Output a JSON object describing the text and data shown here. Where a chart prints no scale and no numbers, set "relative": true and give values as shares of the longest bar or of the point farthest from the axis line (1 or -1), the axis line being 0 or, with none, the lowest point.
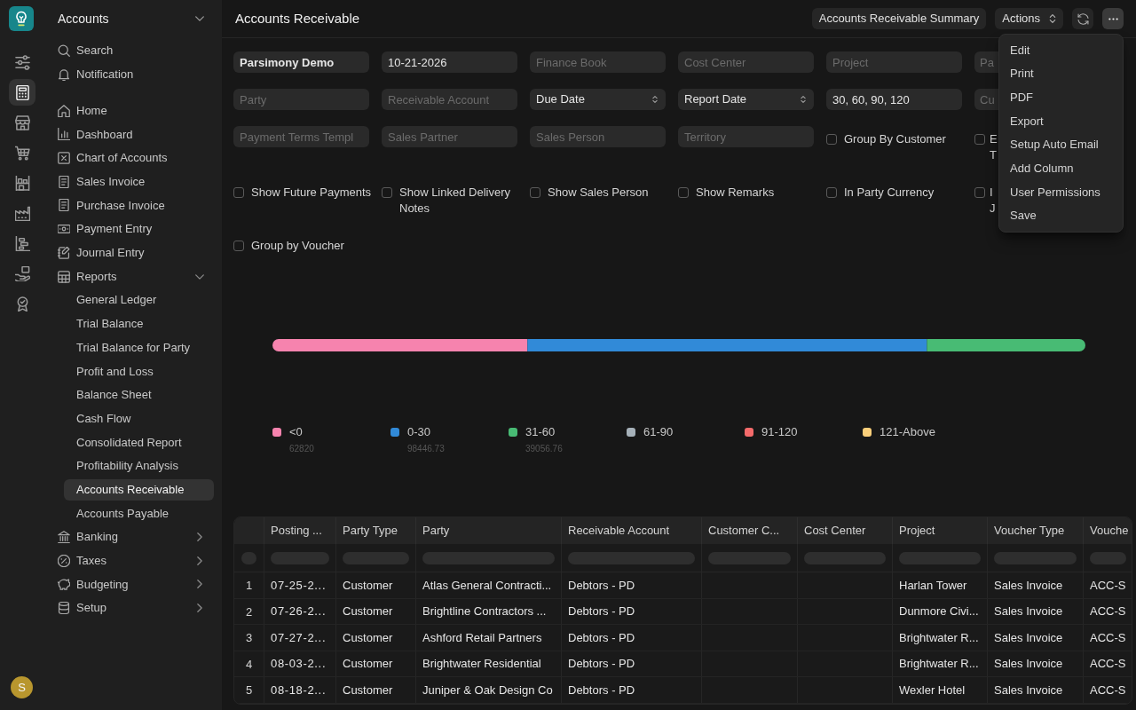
{
  "rail": {
    "items": [
      {
        "selected": false
      },
      {
        "selected": true
      },
      {
        "selected": false
      },
      {
        "selected": false
      },
      {
        "selected": false
      },
      {
        "selected": false
      },
      {
        "selected": false
      },
      {
        "selected": false
      },
      {
        "selected": false
      }
    ]
  },
  "sidebar": {
    "workspace": "Accounts",
    "actions": [
      {
        "label": "Search"
      },
      {
        "label": "Notification"
      }
    ],
    "items": [
      {
        "kind": "link",
        "label": "Home",
        "selected": false
      },
      {
        "kind": "link",
        "label": "Dashboard",
        "selected": false
      },
      {
        "kind": "link",
        "label": "Chart of Accounts",
        "selected": false
      },
      {
        "kind": "link",
        "label": "Sales Invoice",
        "selected": false
      },
      {
        "kind": "link",
        "label": "Purchase Invoice",
        "selected": false
      },
      {
        "kind": "link",
        "label": "Payment Entry",
        "selected": false
      },
      {
        "kind": "link",
        "label": "Journal Entry",
        "selected": false
      },
      {
        "kind": "group",
        "label": "Reports",
        "selected": false,
        "expanded": true,
        "children": [
          {
            "label": "General Ledger",
            "selected": false
          },
          {
            "label": "Trial Balance",
            "selected": false
          },
          {
            "label": "Trial Balance for Party",
            "selected": false
          },
          {
            "label": "Profit and Loss",
            "selected": false
          },
          {
            "label": "Balance Sheet",
            "selected": false
          },
          {
            "label": "Cash Flow",
            "selected": false
          },
          {
            "label": "Consolidated Report",
            "selected": false
          },
          {
            "label": "Profitability Analysis",
            "selected": false
          },
          {
            "label": "Accounts Receivable",
            "selected": true
          },
          {
            "label": "Accounts Payable",
            "selected": false
          }
        ]
      },
      {
        "kind": "group",
        "label": "Banking",
        "selected": false,
        "expanded": false
      },
      {
        "kind": "group",
        "label": "Taxes",
        "selected": false,
        "expanded": false
      },
      {
        "kind": "group",
        "label": "Budgeting",
        "selected": false,
        "expanded": false
      },
      {
        "kind": "group",
        "label": "Setup",
        "selected": false,
        "expanded": false
      }
    ]
  },
  "user": {
    "initial": "S"
  },
  "header": {
    "title": "Accounts Receivable",
    "buttons": [
      {
        "kind": "text",
        "label": "Accounts Receivable Summary"
      },
      {
        "kind": "dropdown",
        "label": "Actions"
      },
      {
        "kind": "refresh"
      },
      {
        "kind": "more",
        "expanded": true
      }
    ]
  },
  "menu": {
    "items": [
      "Edit",
      "Print",
      "PDF",
      "Export",
      "Setup Auto Email",
      "Add Column",
      "User Permissions",
      "Save"
    ]
  },
  "filters": [
    {
      "kind": "link",
      "value": "Parsimony Demo"
    },
    {
      "kind": "date",
      "value": "10-21-2026"
    },
    {
      "kind": "link",
      "placeholder": "Finance Book"
    },
    {
      "kind": "link",
      "placeholder": "Cost Center"
    },
    {
      "kind": "link",
      "placeholder": "Project"
    },
    {
      "kind": "link",
      "placeholder": "Pa"
    },
    {
      "kind": "link",
      "placeholder": "Party"
    },
    {
      "kind": "link",
      "placeholder": "Receivable Account"
    },
    {
      "kind": "select",
      "value": "Due Date"
    },
    {
      "kind": "select",
      "value": "Report Date"
    },
    {
      "kind": "data",
      "value": "30, 60, 90, 120"
    },
    {
      "kind": "link",
      "placeholder": "Cu"
    },
    {
      "kind": "link",
      "placeholder": "Payment Terms Templ"
    },
    {
      "kind": "link",
      "placeholder": "Sales Partner"
    },
    {
      "kind": "link",
      "placeholder": "Sales Person"
    },
    {
      "kind": "link",
      "placeholder": "Territory"
    },
    {
      "kind": "check",
      "label": "Group By Customer",
      "checked": false
    },
    {
      "kind": "check",
      "label": "E T",
      "checked": false
    },
    {
      "kind": "check",
      "label": "Show Future Payments",
      "checked": false
    },
    {
      "kind": "check",
      "label": "Show Linked Delivery Notes",
      "checked": false
    },
    {
      "kind": "check",
      "label": "Show Sales Person",
      "checked": false
    },
    {
      "kind": "check",
      "label": "Show Remarks",
      "checked": false
    },
    {
      "kind": "check",
      "label": "In Party Currency",
      "checked": false
    },
    {
      "kind": "check",
      "label": "I J",
      "checked": false
    },
    {
      "kind": "check",
      "label": "Group by Voucher",
      "checked": false
    }
  ],
  "chart": {
    "chart_data": {
      "type": "bar",
      "orientation": "horizontal",
      "stacked": true,
      "relative": true,
      "legend": "bottom",
      "series": [
        {
          "name": "<0",
          "color": "#f683ae",
          "values": [
            0.31359
          ]
        },
        {
          "name": "0-30",
          "color": "#318ad8",
          "values": [
            0.49144
          ]
        },
        {
          "name": "31-60",
          "color": "#48bb74",
          "values": [
            0.19497
          ]
        },
        {
          "name": "61-90",
          "color": "#a6b1b9",
          "values": [
            0
          ]
        },
        {
          "name": "91-120",
          "color": "#f56b6b",
          "values": [
            0
          ]
        },
        {
          "name": "121-Above",
          "color": "#facf7a",
          "values": [
            0
          ]
        }
      ]
    },
    "legend_values": [
      "62820",
      "98446.73",
      "39056.76"
    ]
  },
  "table": {
    "columns": [
      "Posting ...",
      "Party Type",
      "Party",
      "Receivable Account",
      "Customer C...",
      "Cost Center",
      "Project",
      "Voucher Type",
      "Vouche"
    ],
    "rows": [
      {
        "index": "1",
        "cells": [
          "07-25-2...",
          "Customer",
          "Atlas General Contracti...",
          "Debtors - PD",
          null,
          null,
          "Harlan Tower",
          "Sales Invoice",
          "ACC-S"
        ]
      },
      {
        "index": "2",
        "cells": [
          "07-26-2...",
          "Customer",
          "Brightline Contractors ...",
          "Debtors - PD",
          null,
          null,
          "Dunmore Civi...",
          "Sales Invoice",
          "ACC-S"
        ]
      },
      {
        "index": "3",
        "cells": [
          "07-27-2...",
          "Customer",
          "Ashford Retail Partners",
          "Debtors - PD",
          null,
          null,
          "Brightwater R...",
          "Sales Invoice",
          "ACC-S"
        ]
      },
      {
        "index": "4",
        "cells": [
          "08-03-2...",
          "Customer",
          "Brightwater Residential",
          "Debtors - PD",
          null,
          null,
          "Brightwater R...",
          "Sales Invoice",
          "ACC-S"
        ]
      },
      {
        "index": "5",
        "cells": [
          "08-18-2...",
          "Customer",
          "Juniper & Oak Design Co",
          "Debtors - PD",
          null,
          null,
          "Wexler Hotel",
          "Sales Invoice",
          "ACC-S"
        ]
      }
    ]
  }
}
